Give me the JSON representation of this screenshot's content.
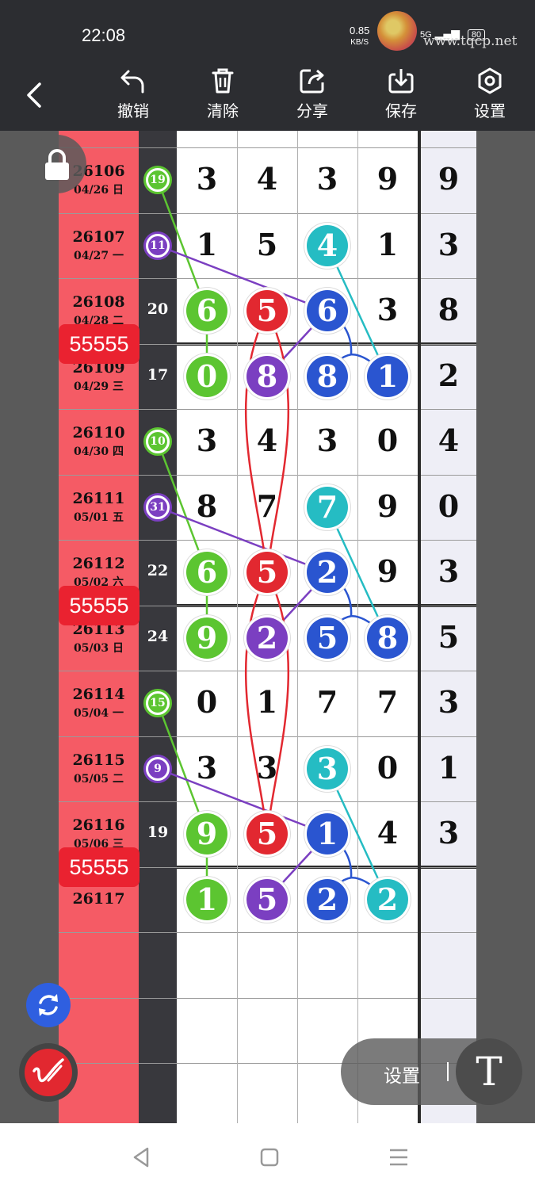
{
  "status_bar": {
    "time": "22:08",
    "speed_value": "0.85",
    "speed_unit": "KB/S",
    "network": "5G",
    "battery": "80"
  },
  "watermark": {
    "site": "www.tqcp.net"
  },
  "toolbar": {
    "undo_label": "撤销",
    "clear_label": "清除",
    "share_label": "分享",
    "save_label": "保存",
    "settings_label": "设置"
  },
  "rows": [
    {
      "issue": "26106",
      "date": "04/26 日",
      "span": "",
      "digits": [
        "3",
        "4",
        "3",
        "9"
      ],
      "sum": "9"
    },
    {
      "issue": "26107",
      "date": "04/27 一",
      "span": "",
      "digits": [
        "1",
        "5",
        "4",
        "1"
      ],
      "sum": "3"
    },
    {
      "issue": "26108",
      "date": "04/28 二",
      "span": "20",
      "digits": [
        "6",
        "5",
        "6",
        "3"
      ],
      "sum": "8"
    },
    {
      "issue": "26109",
      "date": "04/29 三",
      "span": "17",
      "digits": [
        "0",
        "8",
        "8",
        "1"
      ],
      "sum": "2"
    },
    {
      "issue": "26110",
      "date": "04/30 四",
      "span": "",
      "digits": [
        "3",
        "4",
        "3",
        "0"
      ],
      "sum": "4"
    },
    {
      "issue": "26111",
      "date": "05/01 五",
      "span": "",
      "digits": [
        "8",
        "7",
        "7",
        "9"
      ],
      "sum": "0"
    },
    {
      "issue": "26112",
      "date": "05/02 六",
      "span": "22",
      "digits": [
        "6",
        "5",
        "2",
        "9"
      ],
      "sum": "3"
    },
    {
      "issue": "26113",
      "date": "05/03 日",
      "span": "24",
      "digits": [
        "9",
        "2",
        "5",
        "8"
      ],
      "sum": "5"
    },
    {
      "issue": "26114",
      "date": "05/04 一",
      "span": "",
      "digits": [
        "0",
        "1",
        "7",
        "7"
      ],
      "sum": "3"
    },
    {
      "issue": "26115",
      "date": "05/05 二",
      "span": "",
      "digits": [
        "3",
        "3",
        "3",
        "0"
      ],
      "sum": "1"
    },
    {
      "issue": "26116",
      "date": "05/06 三",
      "span": "19",
      "digits": [
        "9",
        "5",
        "1",
        "4"
      ],
      "sum": "3"
    },
    {
      "issue": "26117",
      "date": "",
      "span": "",
      "digits": [
        "1",
        "5",
        "2",
        "2"
      ],
      "sum": ""
    }
  ],
  "balls": [
    {
      "row": 1,
      "col": 2,
      "value": "4",
      "color": "cyan"
    },
    {
      "row": 2,
      "col": 0,
      "value": "6",
      "color": "green"
    },
    {
      "row": 2,
      "col": 1,
      "value": "5",
      "color": "red"
    },
    {
      "row": 2,
      "col": 2,
      "value": "6",
      "color": "blue"
    },
    {
      "row": 3,
      "col": 0,
      "value": "0",
      "color": "green"
    },
    {
      "row": 3,
      "col": 1,
      "value": "8",
      "color": "purple"
    },
    {
      "row": 3,
      "col": 2,
      "value": "8",
      "color": "blue"
    },
    {
      "row": 3,
      "col": 3,
      "value": "1",
      "color": "blue"
    },
    {
      "row": 5,
      "col": 2,
      "value": "7",
      "color": "cyan"
    },
    {
      "row": 6,
      "col": 0,
      "value": "6",
      "color": "green"
    },
    {
      "row": 6,
      "col": 1,
      "value": "5",
      "color": "red"
    },
    {
      "row": 6,
      "col": 2,
      "value": "2",
      "color": "blue"
    },
    {
      "row": 7,
      "col": 0,
      "value": "9",
      "color": "green"
    },
    {
      "row": 7,
      "col": 1,
      "value": "2",
      "color": "purple"
    },
    {
      "row": 7,
      "col": 2,
      "value": "5",
      "color": "blue"
    },
    {
      "row": 7,
      "col": 3,
      "value": "8",
      "color": "blue"
    },
    {
      "row": 9,
      "col": 2,
      "value": "3",
      "color": "cyan"
    },
    {
      "row": 10,
      "col": 0,
      "value": "9",
      "color": "green"
    },
    {
      "row": 10,
      "col": 1,
      "value": "5",
      "color": "red"
    },
    {
      "row": 10,
      "col": 2,
      "value": "1",
      "color": "blue"
    },
    {
      "row": 11,
      "col": 0,
      "value": "1",
      "color": "green"
    },
    {
      "row": 11,
      "col": 1,
      "value": "5",
      "color": "purple"
    },
    {
      "row": 11,
      "col": 2,
      "value": "2",
      "color": "blue"
    },
    {
      "row": 11,
      "col": 3,
      "value": "2",
      "color": "cyan"
    }
  ],
  "markers": [
    {
      "row": 0,
      "value": "19",
      "color": "green"
    },
    {
      "row": 1,
      "value": "11",
      "color": "purple"
    },
    {
      "row": 4,
      "value": "10",
      "color": "green"
    },
    {
      "row": 5,
      "value": "31",
      "color": "purple"
    },
    {
      "row": 8,
      "value": "15",
      "color": "green"
    },
    {
      "row": 9,
      "value": "9",
      "color": "purple"
    }
  ],
  "badges": [
    {
      "after_row": 2,
      "text": "55555"
    },
    {
      "after_row": 6,
      "text": "55555"
    },
    {
      "after_row": 10,
      "text": "55555"
    }
  ],
  "pill": {
    "label": "设置",
    "font_button": "T"
  },
  "colors": {
    "green": "#5cc531",
    "red": "#e22830",
    "purple": "#7b3fc1",
    "blue": "#2a55d0",
    "cyan": "#25bcc3",
    "strip": "#f55b65"
  },
  "icons": [
    "back-arrow-icon",
    "undo-icon",
    "trash-icon",
    "share-icon",
    "download-icon",
    "settings-hexagon-icon",
    "lock-icon",
    "refresh-icon",
    "pen-icon",
    "text-icon",
    "nav-back-icon",
    "nav-home-icon",
    "nav-menu-icon"
  ]
}
